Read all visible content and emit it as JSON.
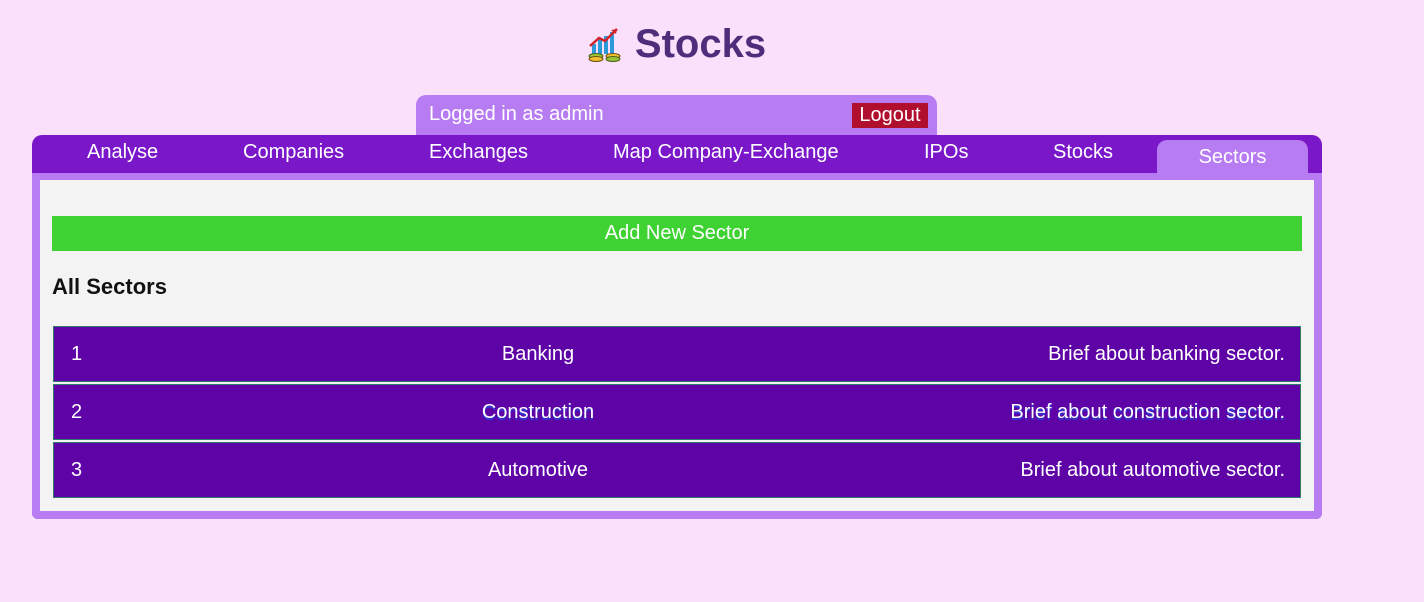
{
  "header": {
    "title": "Stocks",
    "logo_icon": "stocks-chart-icon"
  },
  "user_bar": {
    "logged_in_text": "Logged in as admin",
    "logout_label": "Logout"
  },
  "tabs": [
    {
      "label": "Analyse"
    },
    {
      "label": "Companies"
    },
    {
      "label": "Exchanges"
    },
    {
      "label": "Map Company-Exchange"
    },
    {
      "label": "IPOs"
    },
    {
      "label": "Stocks"
    },
    {
      "label": "Sectors",
      "active": true
    }
  ],
  "main": {
    "add_button_label": "Add New Sector",
    "section_title": "All Sectors",
    "rows": [
      {
        "id": "1",
        "name": "Banking",
        "description": "Brief about banking sector."
      },
      {
        "id": "2",
        "name": "Construction",
        "description": "Brief about construction sector."
      },
      {
        "id": "3",
        "name": "Automotive",
        "description": "Brief about automotive sector."
      }
    ]
  },
  "colors": {
    "background": "#fbe0fb",
    "title": "#4e2d7a",
    "nav": "#7a17c9",
    "accent": "#b77cf2",
    "logout": "#b10f2e",
    "add_button": "#3fd233",
    "row": "#5e04a7"
  }
}
